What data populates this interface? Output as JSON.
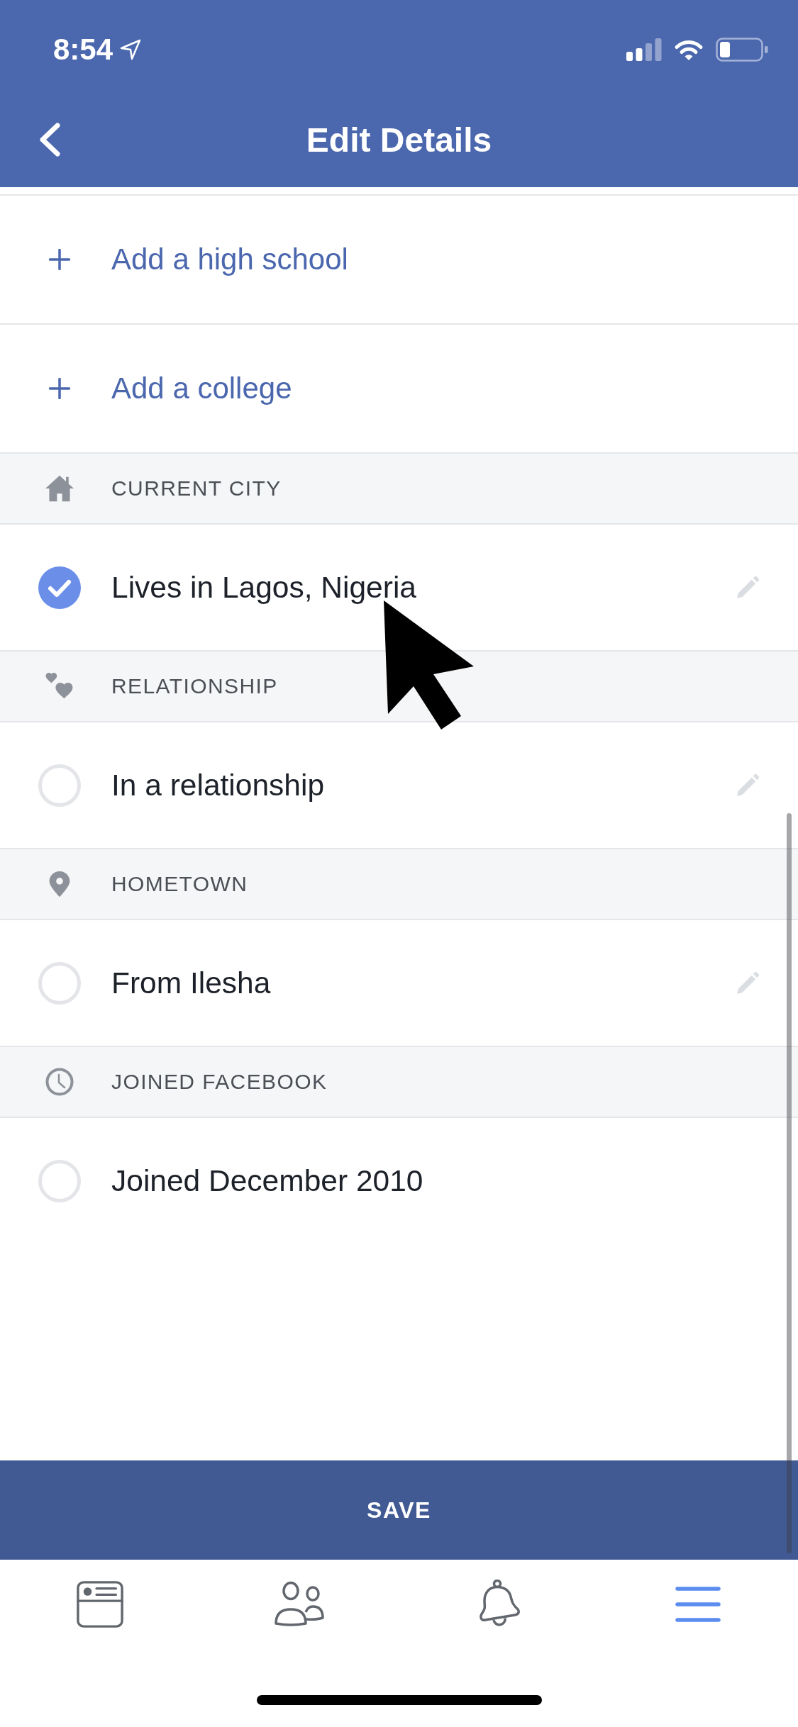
{
  "status_bar": {
    "time": "8:54"
  },
  "nav_bar": {
    "title": "Edit Details"
  },
  "add_links": [
    {
      "label": "Add a high school"
    },
    {
      "label": "Add a college"
    }
  ],
  "sections": [
    {
      "heading": "CURRENT CITY",
      "entry": {
        "text": "Lives in Lagos, Nigeria",
        "selected": true,
        "editable": true
      }
    },
    {
      "heading": "RELATIONSHIP",
      "entry": {
        "text": "In a relationship",
        "selected": false,
        "editable": true
      }
    },
    {
      "heading": "HOMETOWN",
      "entry": {
        "text": "From Ilesha",
        "selected": false,
        "editable": true
      }
    },
    {
      "heading": "JOINED FACEBOOK",
      "entry": {
        "text": "Joined December 2010",
        "selected": false,
        "editable": false
      }
    }
  ],
  "save_button": {
    "label": "SAVE"
  },
  "tab_bar": [
    {
      "selected": false
    },
    {
      "selected": false
    },
    {
      "selected": false
    },
    {
      "selected": true
    }
  ]
}
